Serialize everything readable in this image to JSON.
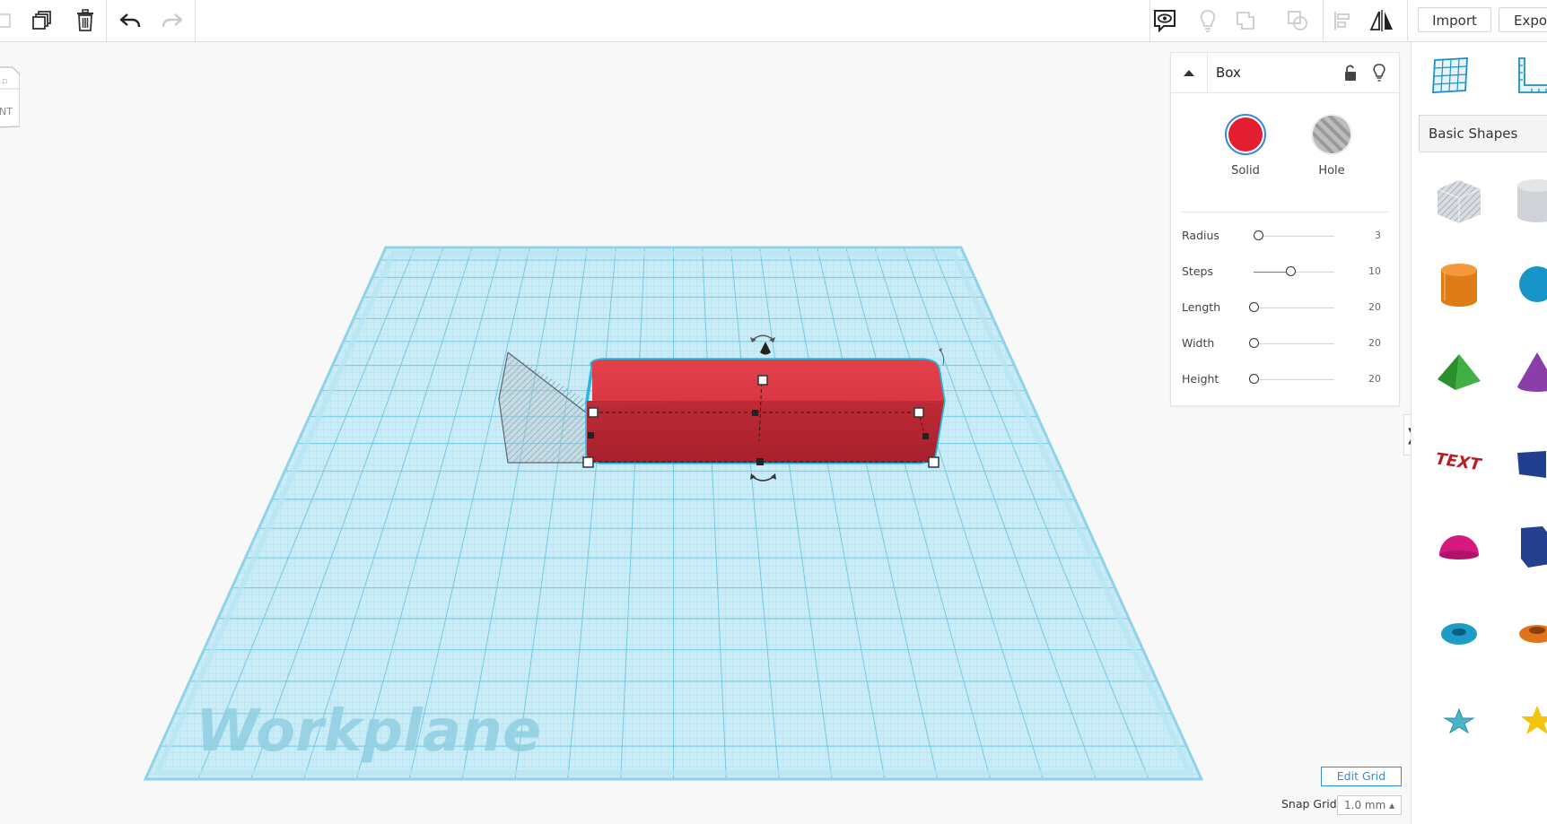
{
  "toolbar": {
    "import_label": "Import",
    "export_label": "Expor"
  },
  "workplane": {
    "label": "Workplane",
    "viewcube_face_text": "NT"
  },
  "inspector": {
    "title": "Box",
    "solid_label": "Solid",
    "hole_label": "Hole",
    "solid_color": "#e31e30",
    "params": [
      {
        "label": "Radius",
        "value": "3",
        "fraction": 0.05
      },
      {
        "label": "Steps",
        "value": "10",
        "fraction": 0.45
      },
      {
        "label": "Length",
        "value": "20",
        "fraction": 0.0
      },
      {
        "label": "Width",
        "value": "20",
        "fraction": 0.0
      },
      {
        "label": "Height",
        "value": "20",
        "fraction": 0.0
      }
    ]
  },
  "library": {
    "category": "Basic Shapes"
  },
  "grid": {
    "edit_label": "Edit Grid",
    "snap_label": "Snap Grid",
    "snap_value": "1.0 mm ▴"
  }
}
